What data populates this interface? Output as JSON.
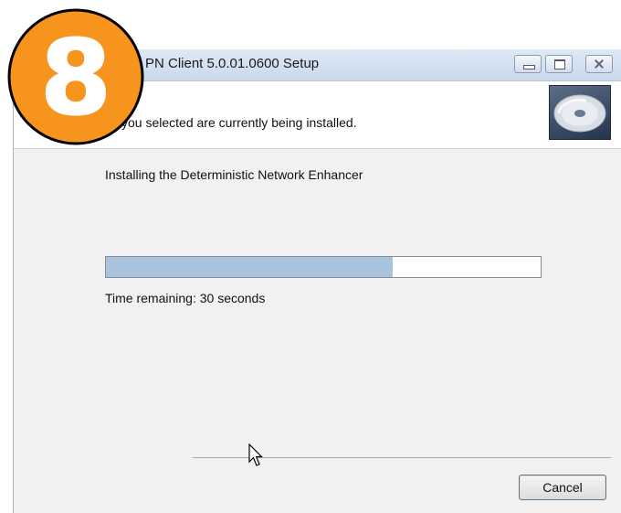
{
  "window": {
    "title": "PN Client 5.0.01.0600 Setup",
    "header_text": "you selected are currently being installed.",
    "status": "Installing the Deterministic Network Enhancer",
    "progress": 0.66,
    "time_remaining": "Time remaining: 30 seconds",
    "cancel_label": "Cancel"
  },
  "overlay": {
    "step_number": "8",
    "badge_color": "#f7941d"
  },
  "colors": {
    "progress_fill": "#aac3dc"
  }
}
